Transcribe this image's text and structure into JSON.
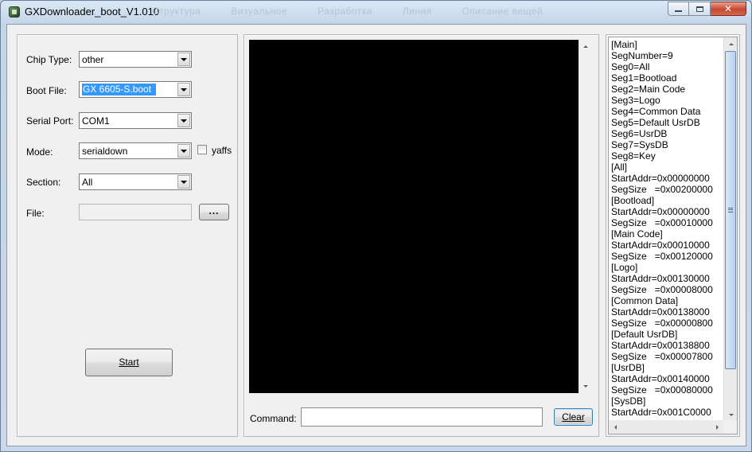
{
  "window": {
    "title": "GXDownloader_boot_V1.010",
    "ghost_menu": [
      "Структура",
      "Визуальное",
      "Разработка",
      "Линия",
      "Описание вещей"
    ]
  },
  "settings": {
    "chip_type": {
      "label": "Chip Type:",
      "value": "other"
    },
    "boot_file": {
      "label": "Boot File:",
      "value": "GX 6605-S.boot"
    },
    "serial_port": {
      "label": "Serial Port:",
      "value": "COM1"
    },
    "mode": {
      "label": "Mode:",
      "value": "serialdown"
    },
    "yaffs": {
      "label": "yaffs",
      "checked": false
    },
    "section": {
      "label": "Section:",
      "value": "All"
    },
    "file": {
      "label": "File:",
      "value": "",
      "browse_label": "..."
    },
    "start_label": "Start"
  },
  "console": {
    "command_label": "Command:",
    "command_value": "",
    "clear_label": "Clear"
  },
  "ini": {
    "lines": [
      "[Main]",
      "SegNumber=9",
      "Seg0=All",
      "Seg1=Bootload",
      "Seg2=Main Code",
      "Seg3=Logo",
      "Seg4=Common Data",
      "Seg5=Default UsrDB",
      "Seg6=UsrDB",
      "Seg7=SysDB",
      "Seg8=Key",
      "[All]",
      "StartAddr=0x00000000",
      "SegSize   =0x00200000",
      "[Bootload]",
      "StartAddr=0x00000000",
      "SegSize   =0x00010000",
      "[Main Code]",
      "StartAddr=0x00010000",
      "SegSize   =0x00120000",
      "[Logo]",
      "StartAddr=0x00130000",
      "SegSize   =0x00008000",
      "[Common Data]",
      "StartAddr=0x00138000",
      "SegSize   =0x00000800",
      "[Default UsrDB]",
      "StartAddr=0x00138800",
      "SegSize   =0x00007800",
      "[UsrDB]",
      "StartAddr=0x00140000",
      "SegSize   =0x00080000",
      "[SysDB]",
      "StartAddr=0x001C0000"
    ]
  }
}
